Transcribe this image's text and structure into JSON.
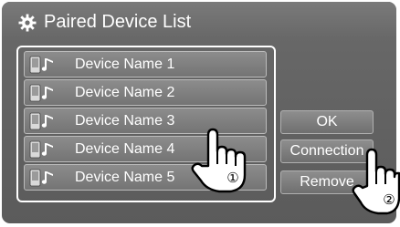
{
  "header": {
    "title": "Paired Device List",
    "icon": "gear-icon"
  },
  "devices": [
    {
      "label": "Device Name 1",
      "icon": "phone-music-icon"
    },
    {
      "label": "Device Name 2",
      "icon": "phone-music-icon"
    },
    {
      "label": "Device Name 3",
      "icon": "phone-music-icon"
    },
    {
      "label": "Device Name 4",
      "icon": "phone-music-icon"
    },
    {
      "label": "Device Name 5",
      "icon": "phone-music-icon"
    }
  ],
  "buttons": {
    "ok": "OK",
    "connection": "Connection",
    "remove": "Remove"
  },
  "callouts": {
    "step1": "①",
    "step2": "②"
  },
  "colors": {
    "screen": "#606060",
    "item": "#7f7f7f",
    "text": "#ffffff"
  }
}
